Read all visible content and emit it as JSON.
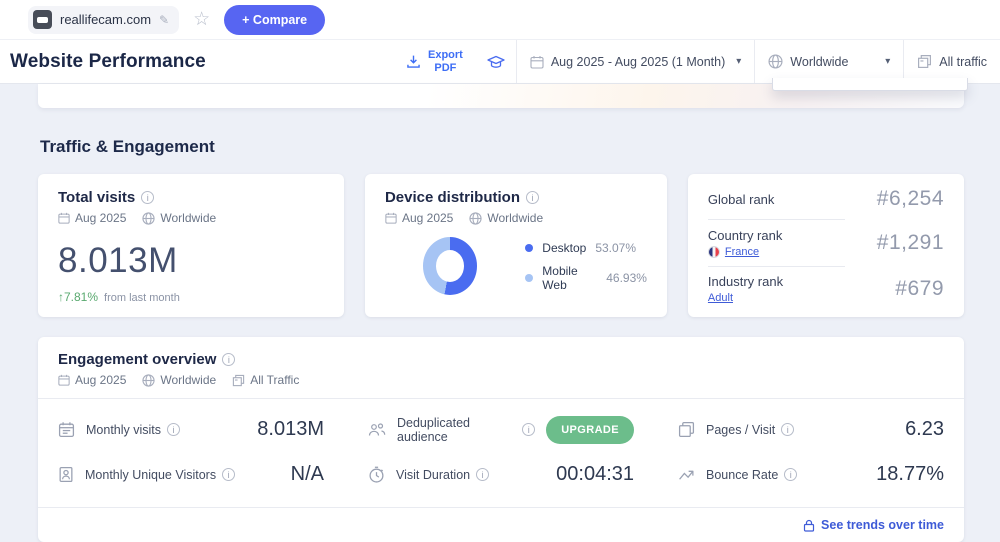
{
  "topbar": {
    "site_name": "reallifecam.com",
    "compare_button": "+ Compare"
  },
  "header": {
    "title": "Website Performance",
    "export_line1": "Export",
    "export_line2": "PDF",
    "date_range": "Aug 2025 - Aug 2025 (1 Month)",
    "country_selector": "Worldwide",
    "traffic_selector": "All traffic"
  },
  "section_title": "Traffic & Engagement",
  "total_visits": {
    "title": "Total visits",
    "period": "Aug 2025",
    "region": "Worldwide",
    "value": "8.013M",
    "change": "↑7.81%",
    "change_note": "from last month"
  },
  "device_distribution": {
    "title": "Device distribution",
    "period": "Aug 2025",
    "region": "Worldwide"
  },
  "chart_data": {
    "type": "pie",
    "donut": true,
    "title": "Device distribution",
    "categories": [
      "Desktop",
      "Mobile Web"
    ],
    "values": [
      53.07,
      46.93
    ],
    "value_labels": [
      "53.07%",
      "46.93%"
    ],
    "colors": [
      "#4a6cf0",
      "#a6c4f4"
    ],
    "legend_position": "right"
  },
  "ranks": {
    "rows": [
      {
        "label": "Global rank",
        "value": "#6,254"
      },
      {
        "label": "Country rank",
        "link": "France",
        "value": "#1,291"
      },
      {
        "label": "Industry rank",
        "link": "Adult",
        "value": "#679"
      }
    ]
  },
  "engagement": {
    "title": "Engagement overview",
    "period": "Aug 2025",
    "region": "Worldwide",
    "traffic": "All Traffic",
    "metrics": [
      {
        "icon": "calendar-icon",
        "label": "Monthly visits",
        "value": "8.013M"
      },
      {
        "icon": "audience-icon",
        "label": "Deduplicated audience",
        "value": "UPGRADE"
      },
      {
        "icon": "pages-icon",
        "label": "Pages / Visit",
        "value": "6.23"
      },
      {
        "icon": "unique-visitors-icon",
        "label": "Monthly Unique Visitors",
        "value": "N/A"
      },
      {
        "icon": "clock-icon",
        "label": "Visit Duration",
        "value": "00:04:31"
      },
      {
        "icon": "bounce-icon",
        "label": "Bounce Rate",
        "value": "18.77%"
      }
    ],
    "footer_link": "See trends over time"
  },
  "icons": [
    "star-icon",
    "pencil-icon",
    "download-icon",
    "graduation-cap-icon",
    "calendar-icon",
    "globe-icon",
    "traffic-layers-icon",
    "info-icon",
    "lock-icon",
    "france-flag-icon"
  ],
  "colors": {
    "accent_blue": "#3e6ef5",
    "link_blue": "#3e5bd7",
    "compare_blue": "#5765f2",
    "upgrade_green": "#6cbd8b",
    "change_green": "#59a96f",
    "desktop_blue": "#4a6cf0",
    "mobile_web_blue": "#a6c4f4"
  }
}
